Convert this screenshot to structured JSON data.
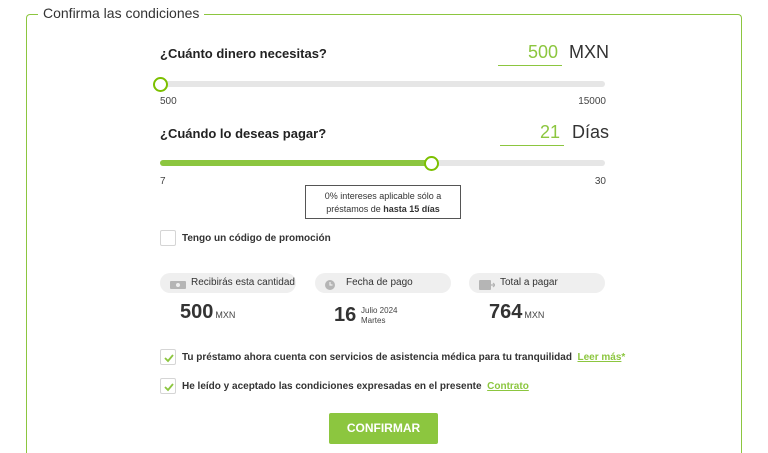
{
  "legend": "Confirma las condiciones",
  "amount": {
    "question": "¿Cuánto dinero necesitas?",
    "value": "500",
    "unit": "MXN",
    "min": "500",
    "max": "15000",
    "slider_fraction": 0.0
  },
  "term": {
    "question": "¿Cuándo lo deseas pagar?",
    "value": "21",
    "unit": "Días",
    "min": "7",
    "max": "30",
    "slider_fraction": 0.6087
  },
  "info": {
    "line1": "0% intereses aplicable sólo a",
    "line2_prefix": "préstamos de ",
    "line2_bold": "hasta 15 días"
  },
  "promo": {
    "label": "Tengo un código de promoción",
    "checked": false
  },
  "summary": {
    "receive": {
      "pill": "Recibirás esta cantidad",
      "value": "500",
      "unit": "MXN",
      "icon": "money-icon"
    },
    "date": {
      "pill": "Fecha de pago",
      "day": "16",
      "month_year": "Julio 2024",
      "weekday": "Martes",
      "icon": "clock-icon"
    },
    "total": {
      "pill": "Total a pagar",
      "value": "764",
      "unit": "MXN",
      "icon": "card-icon"
    }
  },
  "assistance": {
    "label": "Tu préstamo ahora cuenta con servicios de asistencia médica para tu tranquilidad",
    "link": "Leer más",
    "suffix": "*",
    "checked": true
  },
  "terms": {
    "label": "He leído y aceptado las condiciones expresadas en el presente",
    "link": "Contrato",
    "checked": true
  },
  "confirm_label": "CONFIRMAR",
  "colors": {
    "accent": "#8cc63f",
    "track": "#e6e6e6",
    "pill_bg": "#efefef"
  }
}
